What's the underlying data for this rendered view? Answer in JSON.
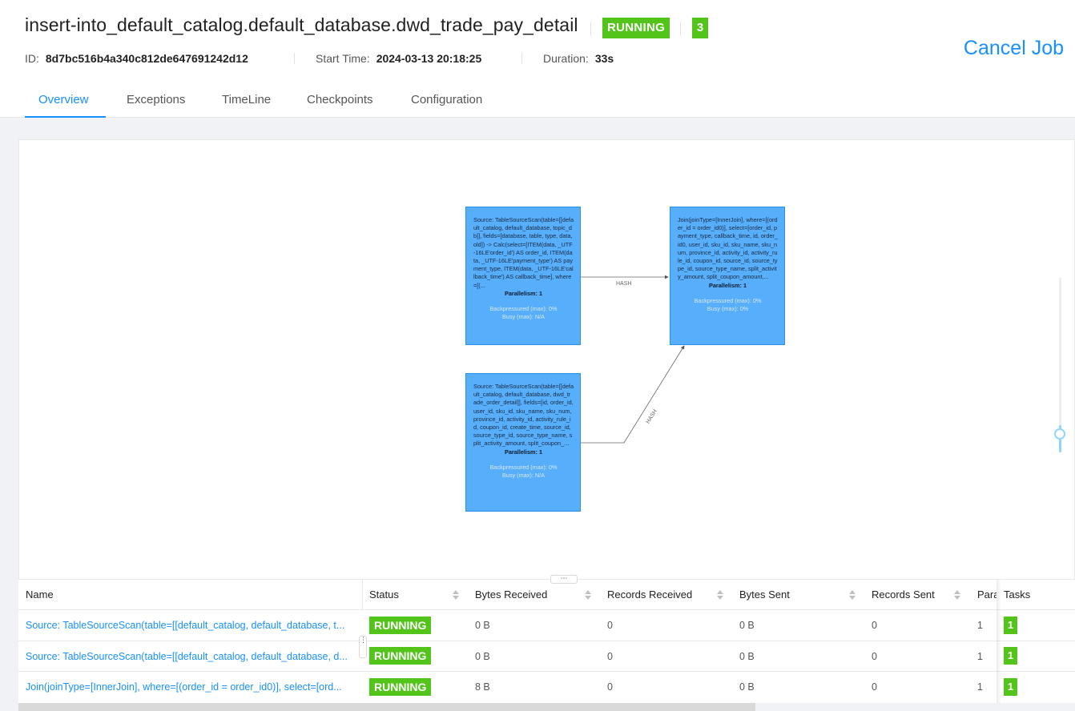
{
  "job": {
    "title": "insert-into_default_catalog.default_database.dwd_trade_pay_detail",
    "status": "RUNNING",
    "task_count": "3",
    "id_label": "ID:",
    "id": "8d7bc516b4a340c812de647691242d12",
    "start_time_label": "Start Time:",
    "start_time": "2024-03-13 20:18:25",
    "duration_label": "Duration:",
    "duration": "33s",
    "cancel_label": "Cancel Job"
  },
  "tabs": [
    {
      "label": "Overview",
      "active": true
    },
    {
      "label": "Exceptions"
    },
    {
      "label": "TimeLine"
    },
    {
      "label": "Checkpoints"
    },
    {
      "label": "Configuration"
    }
  ],
  "graph": {
    "nodes": [
      {
        "description": "Source: TableSourceScan(table=[[default_catalog, default_database, topic_db]], fields=[database, table, type, data, old]) -> Calc(select=[ITEM(data, _UTF-16LE'order_id') AS order_id, ITEM(data, _UTF-16LE'payment_type') AS payment_type, ITEM(data, _UTF-16LE'callback_time') AS callback_time], where=[(...",
        "parallelism": "Parallelism: 1",
        "backpressured": "Backpressured (max): 0%",
        "busy": "Busy (max): N/A"
      },
      {
        "description": "Source: TableSourceScan(table=[[default_catalog, default_database, dwd_trade_order_detail]], fields=[id, order_id, user_id, sku_id, sku_name, sku_num, province_id, activity_id, activity_rule_id, coupon_id, create_time, source_id, source_type_id, source_type_name, split_activity_amount, split_coupon_...",
        "parallelism": "Parallelism: 1",
        "backpressured": "Backpressured (max): 0%",
        "busy": "Busy (max): N/A"
      },
      {
        "description": "Join(joinType=[InnerJoin], where=[(order_id = order_id0)], select=[order_id, payment_type, callback_time, id, order_id0, user_id, sku_id, sku_name, sku_num, province_id, activity_id, activity_rule_id, coupon_id, source_id, source_type_id, source_type_name, split_activity_amount, split_coupon_amount,...",
        "parallelism": "Parallelism: 1",
        "backpressured": "Backpressured (max): 0%",
        "busy": "Busy (max): 0%"
      }
    ],
    "edges": [
      {
        "from": 0,
        "to": 2,
        "label": "HASH"
      },
      {
        "from": 1,
        "to": 2,
        "label": "HASH"
      }
    ],
    "splitter_label": "⋯"
  },
  "table": {
    "columns": {
      "name": "Name",
      "status": "Status",
      "bytes_received": "Bytes Received",
      "records_received": "Records Received",
      "bytes_sent": "Bytes Sent",
      "records_sent": "Records Sent",
      "parallelism": "Para",
      "tasks": "Tasks"
    },
    "rows": [
      {
        "name": "Source: TableSourceScan(table=[[default_catalog, default_database, t...",
        "status": "RUNNING",
        "bytes_received": "0 B",
        "records_received": "0",
        "bytes_sent": "0 B",
        "records_sent": "0",
        "parallelism": "1",
        "tasks": "1"
      },
      {
        "name": "Source: TableSourceScan(table=[[default_catalog, default_database, d...",
        "status": "RUNNING",
        "bytes_received": "0 B",
        "records_received": "0",
        "bytes_sent": "0 B",
        "records_sent": "0",
        "parallelism": "1",
        "tasks": "1"
      },
      {
        "name": "Join(joinType=[InnerJoin], where=[(order_id = order_id0)], select=[ord...",
        "status": "RUNNING",
        "bytes_received": "8 B",
        "records_received": "0",
        "bytes_sent": "0 B",
        "records_sent": "0",
        "parallelism": "1",
        "tasks": "1"
      }
    ]
  },
  "colors": {
    "accent": "#1890ff",
    "running": "#52c41a",
    "node_fill": "#57aefb"
  }
}
